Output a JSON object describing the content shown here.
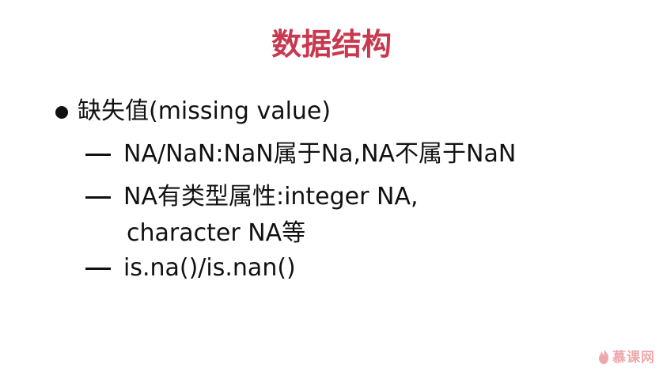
{
  "slide": {
    "title": "数据结构",
    "title_color": "#c8384e",
    "bullet": {
      "icon": "bullet-dot-icon",
      "text": "缺失值(missing value)"
    },
    "sub_items": [
      {
        "icon": "dash-icon",
        "text": "NA/NaN:NaN属于Na,NA不属于NaN"
      },
      {
        "icon": "dash-icon",
        "text": "NA有类型属性:integer NA,",
        "continuation": "character NA等"
      },
      {
        "icon": "dash-icon",
        "text": "is.na()/is.nan()"
      }
    ]
  },
  "watermark": {
    "icon": "flame-logo-icon",
    "text": "慕课网",
    "color": "#e2606a"
  }
}
